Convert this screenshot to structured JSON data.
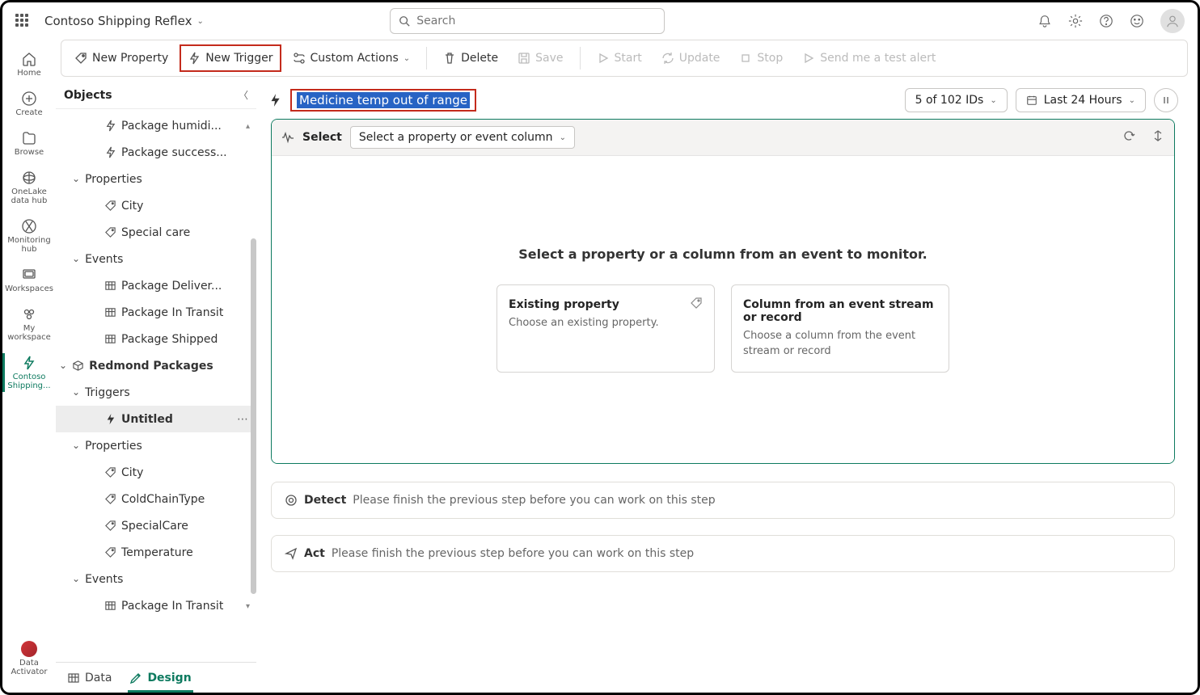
{
  "header": {
    "app_name": "Contoso Shipping Reflex",
    "search_placeholder": "Search"
  },
  "nav": [
    {
      "label": "Home"
    },
    {
      "label": "Create"
    },
    {
      "label": "Browse"
    },
    {
      "label": "OneLake data hub"
    },
    {
      "label": "Monitoring hub"
    },
    {
      "label": "Workspaces"
    },
    {
      "label": "My workspace"
    },
    {
      "label": "Contoso Shipping..."
    }
  ],
  "nav_bottom_label": "Data Activator",
  "ribbon": {
    "new_property": "New Property",
    "new_trigger": "New Trigger",
    "custom_actions": "Custom Actions",
    "delete": "Delete",
    "save": "Save",
    "start": "Start",
    "update": "Update",
    "stop": "Stop",
    "send_test": "Send me a test alert"
  },
  "objects": {
    "title": "Objects",
    "items": [
      {
        "label": "Package humidi...",
        "icon": "trigger"
      },
      {
        "label": "Package success...",
        "icon": "trigger"
      },
      {
        "label": "Properties",
        "group": true
      },
      {
        "label": "City",
        "icon": "tag"
      },
      {
        "label": "Special care",
        "icon": "tag"
      },
      {
        "label": "Events",
        "group": true
      },
      {
        "label": "Package Deliver...",
        "icon": "table"
      },
      {
        "label": "Package In Transit",
        "icon": "table"
      },
      {
        "label": "Package Shipped",
        "icon": "table"
      },
      {
        "label": "Redmond Packages",
        "icon": "cube",
        "top": true
      },
      {
        "label": "Triggers",
        "group": true
      },
      {
        "label": "Untitled",
        "icon": "bolt",
        "selected": true
      },
      {
        "label": "Properties",
        "group": true
      },
      {
        "label": "City",
        "icon": "tag"
      },
      {
        "label": "ColdChainType",
        "icon": "tag"
      },
      {
        "label": "SpecialCare",
        "icon": "tag"
      },
      {
        "label": "Temperature",
        "icon": "tag"
      },
      {
        "label": "Events",
        "group": true
      },
      {
        "label": "Package In Transit",
        "icon": "table"
      }
    ]
  },
  "bottom_tabs": {
    "data": "Data",
    "design": "Design"
  },
  "crumb": {
    "title_value": "Medicine temp out of range",
    "ids_label": "5 of 102 IDs",
    "time_label": "Last 24 Hours"
  },
  "select_step": {
    "label": "Select",
    "dropdown": "Select a property or event column",
    "prompt": "Select a property or a column from an event to monitor.",
    "opt1_title": "Existing property",
    "opt1_sub": "Choose an existing property.",
    "opt2_title": "Column from an event stream or record",
    "opt2_sub": "Choose a column from the event stream or record"
  },
  "detect_step": {
    "name": "Detect",
    "msg": "Please finish the previous step before you can work on this step"
  },
  "act_step": {
    "name": "Act",
    "msg": "Please finish the previous step before you can work on this step"
  }
}
